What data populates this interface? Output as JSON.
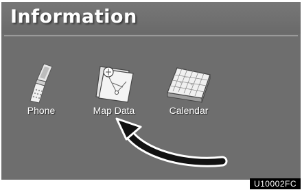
{
  "header": {
    "title": "Information"
  },
  "menu": {
    "items": [
      {
        "label": "Phone",
        "icon": "mobile-phone-icon"
      },
      {
        "label": "Map Data",
        "icon": "map-data-icon"
      },
      {
        "label": "Calendar",
        "icon": "calendar-icon"
      }
    ]
  },
  "figure": {
    "code": "U10002FC"
  }
}
